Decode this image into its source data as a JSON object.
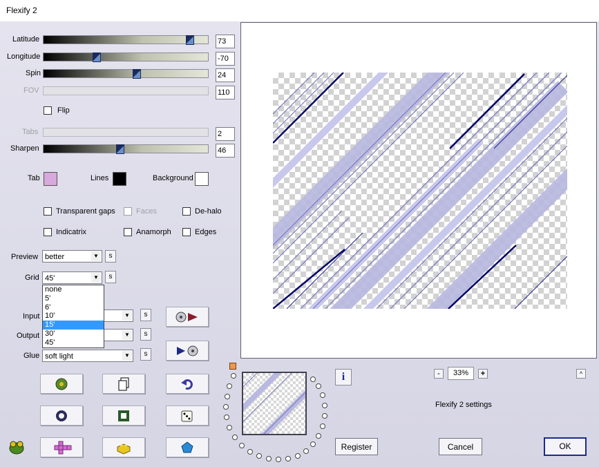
{
  "window": {
    "title": "Flexify 2"
  },
  "sliders": [
    {
      "label": "Latitude",
      "value": "73",
      "fraction": 0.88,
      "enabled": true
    },
    {
      "label": "Longitude",
      "value": "-70",
      "fraction": 0.31,
      "enabled": true
    },
    {
      "label": "Spin",
      "value": "24",
      "fraction": 0.57,
      "enabled": true
    },
    {
      "label": "FOV",
      "value": "110",
      "fraction": 0,
      "enabled": false
    },
    {
      "label": "Tabs",
      "value": "2",
      "fraction": 0,
      "enabled": false
    },
    {
      "label": "Sharpen",
      "value": "46",
      "fraction": 0.46,
      "enabled": true
    }
  ],
  "flip_label": "Flip",
  "colors": {
    "tab_label": "Tab",
    "tab_color": "#d7a9dc",
    "lines_label": "Lines",
    "lines_color": "#000000",
    "background_label": "Background",
    "background_color": "#ffffff"
  },
  "options": {
    "transparent_gaps": "Transparent gaps",
    "faces": "Faces",
    "de_halo": "De-halo",
    "indicatrix": "Indicatrix",
    "anamorph": "Anamorph",
    "edges": "Edges"
  },
  "preview": {
    "label": "Preview",
    "value": "better"
  },
  "grid": {
    "label": "Grid",
    "value": "45'",
    "options": [
      "none",
      "5'",
      "6'",
      "10'",
      "15'",
      "30'",
      "45'"
    ],
    "highlighted": "15'"
  },
  "input": {
    "label": "Input"
  },
  "output": {
    "label": "Output"
  },
  "glue": {
    "label": "Glue",
    "value": "soft light"
  },
  "s_label": "s",
  "zoom": {
    "value": "33%",
    "minus": "-",
    "plus": "+"
  },
  "settings_title": "Flexify 2 settings",
  "info_label": "i",
  "collapse_label": "^",
  "buttons": {
    "register": "Register",
    "cancel": "Cancel",
    "ok": "OK"
  }
}
